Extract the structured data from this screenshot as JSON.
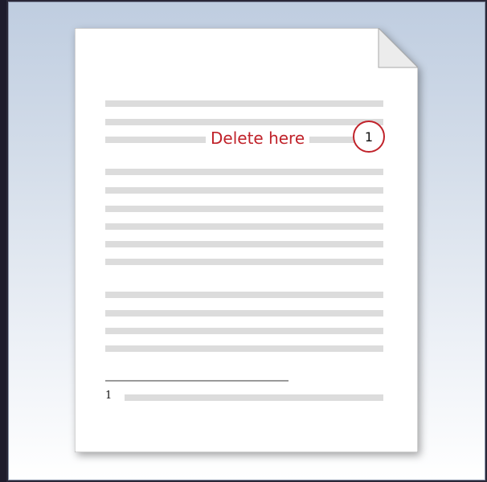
{
  "callout": {
    "label": "Delete here",
    "number": "1"
  },
  "footnote": {
    "number": "1"
  },
  "colors": {
    "accent": "#c0222a",
    "text_line": "#dcdcdc",
    "background_top": "#bfcde0",
    "background_bottom": "#ffffff"
  }
}
